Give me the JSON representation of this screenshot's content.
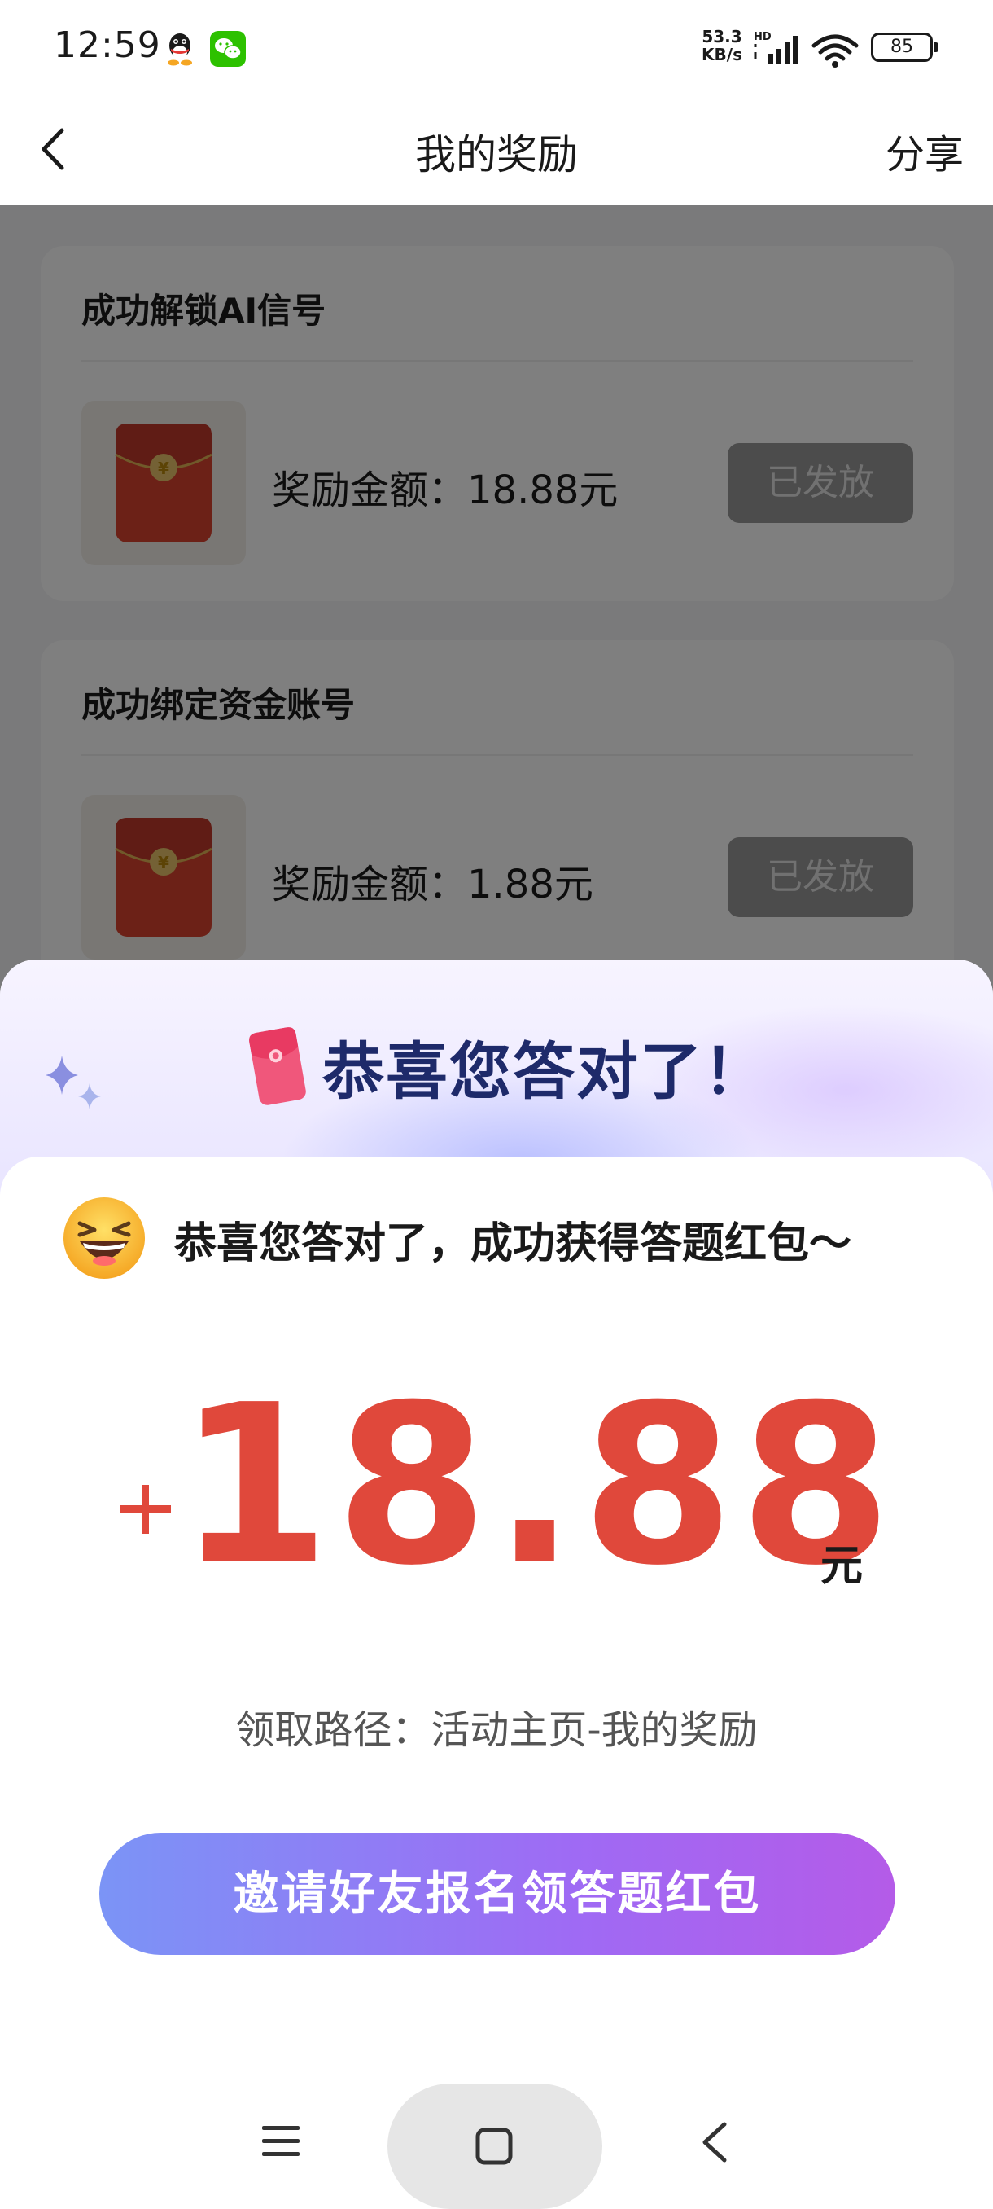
{
  "status_bar": {
    "time": "12:59",
    "net_speed_value": "53.3",
    "net_speed_unit": "KB/s",
    "network_type": "HD",
    "battery_level": "85",
    "icons": [
      "qq-icon",
      "wechat-icon",
      "signal-icon",
      "wifi-icon",
      "battery-icon"
    ]
  },
  "nav": {
    "title": "我的奖励",
    "share_label": "分享"
  },
  "rewards": [
    {
      "title": "成功解锁AI信号",
      "amount": "奖励金额：18.88元",
      "status": "已发放"
    },
    {
      "title": "成功绑定资金账号",
      "amount": "奖励金额：1.88元",
      "status": "已发放"
    }
  ],
  "dialog": {
    "heading": "恭喜您答对了！",
    "message": "恭喜您答对了，成功获得答题红包～",
    "amount": "18.88",
    "unit": "元",
    "claim_path": "领取路径：活动主页-我的奖励",
    "invite_button": "邀请好友报名领答题红包"
  },
  "colors": {
    "amount": "#e0483b",
    "heading": "#1e2a6a",
    "button_gradient_start": "#7b94f6",
    "button_gradient_end": "#b45be8",
    "issued_button": "#999999"
  }
}
